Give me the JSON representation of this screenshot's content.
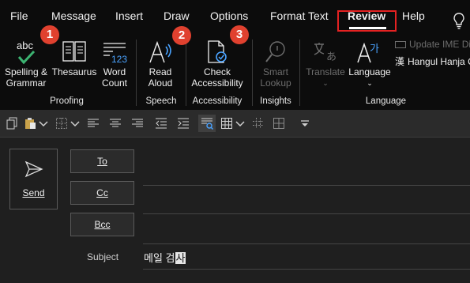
{
  "menu": {
    "items": [
      "File",
      "Message",
      "Insert",
      "Draw",
      "Options",
      "Format Text",
      "Review",
      "Help"
    ],
    "active": "Review",
    "bulb_icon": "lightbulb-icon"
  },
  "ribbon": {
    "proofing": {
      "label": "Proofing",
      "spelling": {
        "line1": "Spelling &",
        "line2": "Grammar",
        "icon_text": "abc"
      },
      "thesaurus": {
        "label": "Thesaurus"
      },
      "word_count": {
        "line1": "Word",
        "line2": "Count",
        "icon_text": "123"
      }
    },
    "speech": {
      "label": "Speech",
      "read_aloud": {
        "line1": "Read",
        "line2": "Aloud"
      }
    },
    "accessibility": {
      "label": "Accessibility",
      "check": {
        "line1": "Check",
        "line2": "Accessibility"
      }
    },
    "insights": {
      "label": "Insights",
      "smart_lookup": {
        "line1": "Smart",
        "line2": "Lookup"
      }
    },
    "language": {
      "label": "Language",
      "translate": {
        "label": "Translate"
      },
      "language_btn": {
        "label": "Language",
        "icon_text": "가"
      },
      "update_ime": "Update IME Dic",
      "hangul_hanja": {
        "icon_text": "漢",
        "label": "Hangul Hanja C"
      }
    },
    "badges": [
      "1",
      "2",
      "3"
    ]
  },
  "compose": {
    "send": "Send",
    "to": "To",
    "cc": "Cc",
    "bcc": "Bcc",
    "subject_label": "Subject",
    "subject_text": "메일 검",
    "subject_selected": "사"
  },
  "colors": {
    "accent_red": "#e52222",
    "badge": "#e0412f",
    "spell_check": "#3cb371",
    "word_count_blue": "#4aa3ff"
  }
}
